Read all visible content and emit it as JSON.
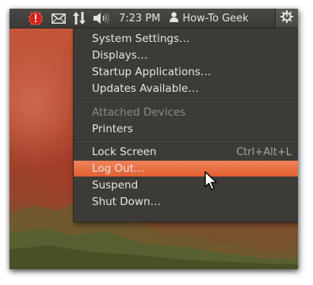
{
  "top_panel": {
    "indicators": [
      "update-alert-icon",
      "mail-icon",
      "network-icon",
      "volume-icon"
    ],
    "clock": "7:23 PM",
    "user_name": "How-To Geek",
    "session_icon": "power-gear-icon"
  },
  "menu": {
    "group1": {
      "system_settings": "System Settings…",
      "displays": "Displays…",
      "startup_applications": "Startup Applications…",
      "updates_available": "Updates Available…"
    },
    "group2": {
      "attached_devices": "Attached Devices",
      "printers": "Printers"
    },
    "group3": {
      "lock_screen": "Lock Screen",
      "lock_screen_shortcut": "Ctrl+Alt+L",
      "log_out": "Log Out…",
      "suspend": "Suspend",
      "shut_down": "Shut Down…"
    },
    "highlighted_item": "Log Out…"
  },
  "colors": {
    "panel": "#3c3b37",
    "highlight": "#e8693c",
    "text": "#e9e6df",
    "disabled_text": "#8e8b84"
  }
}
